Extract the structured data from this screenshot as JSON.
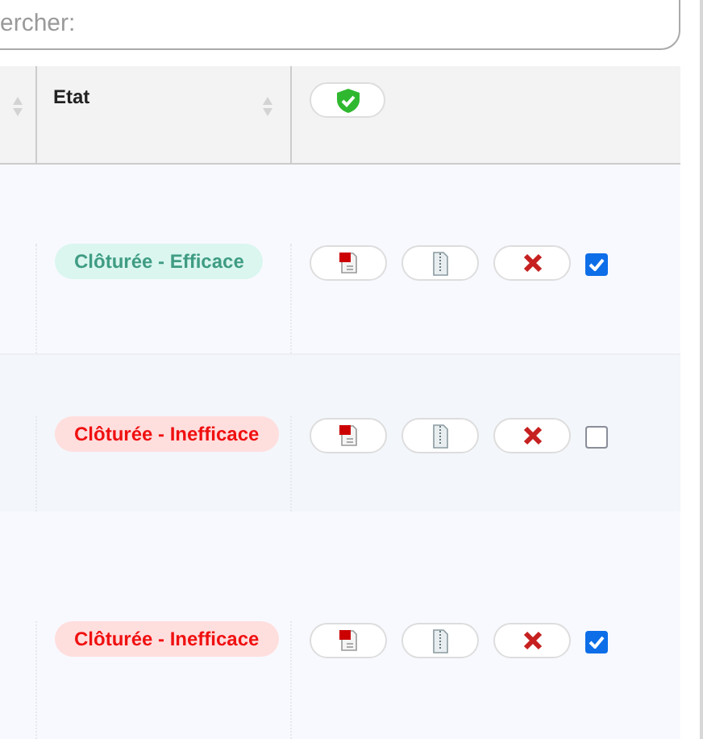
{
  "search": {
    "placeholder": "ercher:"
  },
  "table": {
    "columns": [
      {
        "label": "Etat"
      }
    ],
    "rows": [
      {
        "status": {
          "label": "Clôturée - Efficace",
          "kind": "effective"
        },
        "checked": true
      },
      {
        "status": {
          "label": "Clôturée - Inefficace",
          "kind": "ineffective"
        },
        "checked": false
      },
      {
        "status": {
          "label": "Clôturée - Inefficace",
          "kind": "ineffective"
        },
        "checked": true
      }
    ]
  }
}
